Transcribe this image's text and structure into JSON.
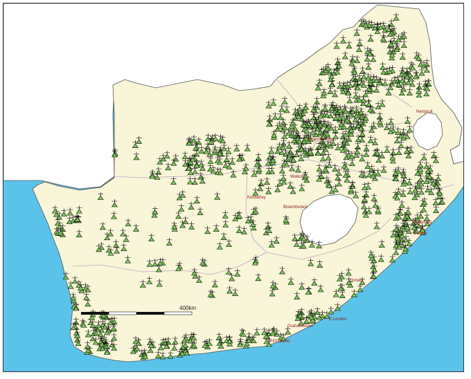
{
  "map": {
    "colors": {
      "ocean": "#5bc3ea",
      "land": "#f8f5d8",
      "neighbor": "#ffffff",
      "border": "#b9a8c8",
      "marker_fill": "#7cc45a",
      "marker_stroke": "#111111",
      "label": "#8b1a1a"
    },
    "scale_bar": {
      "label": "400km"
    },
    "cities": [
      {
        "name": "Polokwane",
        "display": ""
      },
      {
        "name": "Nelspruit",
        "display": "Nelspruit"
      },
      {
        "name": "Johannesburg",
        "display": "Johannesburg"
      },
      {
        "name": "Klerksdorp",
        "display": "Klerksdorp"
      },
      {
        "name": "Welkom",
        "display": "Welkom"
      },
      {
        "name": "Kimberley",
        "display": "Kimberley"
      },
      {
        "name": "Bloemfontein",
        "display": "Bloemfontein"
      },
      {
        "name": "Pietermaritzburg",
        "display": "Maritzburg"
      },
      {
        "name": "Durban",
        "display": "Durban"
      },
      {
        "name": "Umtata",
        "display": "Umtata"
      },
      {
        "name": "East London",
        "display": "E.London"
      },
      {
        "name": "Grahamstown",
        "display": "Grahamstown"
      },
      {
        "name": "Port Elizabeth",
        "display": "P.Elizabeth"
      }
    ],
    "marker_icon": "telecom-tower-marker-icon"
  }
}
